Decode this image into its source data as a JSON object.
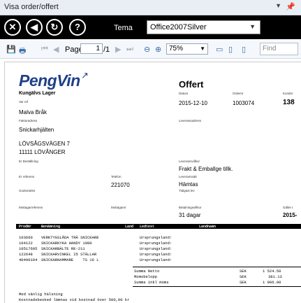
{
  "window": {
    "title": "Visa order/offert",
    "pin_icon": "pin-icon",
    "dropdown_icon": "chevron-down-icon"
  },
  "nav": {
    "tema_label": "Tema",
    "theme_value": "Office2007Silver"
  },
  "toolbar": {
    "page_label": "Page",
    "page_value": "1",
    "page_total": "/1",
    "zoom_value": "75%",
    "find_placeholder": "Find"
  },
  "doc": {
    "company": "PengVin",
    "title": "Offert",
    "customer_company": "Kungälvs Lager",
    "lbl_var_ref": "Var ref",
    "our_ref": "Malva Bråk",
    "lbl_faktura": "Fakturadress",
    "invoice_name": "Snickarhjälten",
    "street": "LÖVSÅGSVÄGEN 7",
    "zip_city": "11111   LÖVÅNGER",
    "lbl_er_bestallning": "Er Beställning",
    "lbl_er_referens": "Er referens",
    "lbl_telefon": "Telefon",
    "phone": "221070",
    "lbl_godsmarke": "Godsmärke",
    "lbl_mottagarreferens": "Mottagarreferens",
    "lbl_mottagarnr": "Mottagarnr",
    "lbl_datum": "Datum",
    "date": "2015-12-10",
    "lbl_ordernr": "Ordernr",
    "order_no": "1003074",
    "lbl_kundnr": "Kundnr",
    "customer_no": "138",
    "lbl_leveransadress": "Leveransadress",
    "lbl_leveransvillkor": "Leveransvillkor",
    "delivery_terms": "Frakt & Emballge tillk.",
    "lbl_leveranssatt": "Leveranssätt",
    "delivery_method": "Hämtas",
    "lbl_tidigast": "Tidigast lev",
    "lbl_betalningsvillkor": "Betalningsvillkor",
    "payment_terms": "31 dagar",
    "lbl_galler": "Gäller t",
    "valid_until": "2015-",
    "table_headers": {
      "prodnr": "ProdNr",
      "benamning": "Benämning",
      "land": "Land",
      "ledtext": "Ledtext",
      "landnamn": "Landnamn"
    },
    "rows": [
      {
        "prodnr": "103660",
        "benamning": "VERKTYGSLÅDA TRÄ SNICKARE",
        "ledtext": "Ursprungsland:"
      },
      {
        "prodnr": "104122",
        "benamning": "SNICKARKYKA HANDY 1000",
        "ledtext": "Ursprungsland:"
      },
      {
        "prodnr": "10517605",
        "benamning": "SNICKARBÄLTE RE-211",
        "ledtext": "Ursprungsland:"
      },
      {
        "prodnr": "122648",
        "benamning": "SNICKARVINKEL 25 STÄLLAR",
        "ledtext": "Ursprungsland:"
      },
      {
        "prodnr": "40490104",
        "benamning": "SNICKARHAMMARE    TS 16 L",
        "ledtext": "Ursprungsland:"
      }
    ],
    "totals": [
      {
        "label": "Summa Netto",
        "currency": "SEK",
        "amount": "1 524.50"
      },
      {
        "label": "Momsbelopp",
        "currency": "SEK",
        "amount": "381.13"
      },
      {
        "label": "Summa inkl moms",
        "currency": "SEK",
        "amount": "1 906.00"
      }
    ],
    "footer_1": "Med vänlig hälsning",
    "footer_2": "Kostnadsbesked lämnas vid kostnad över 500,00 kr"
  }
}
